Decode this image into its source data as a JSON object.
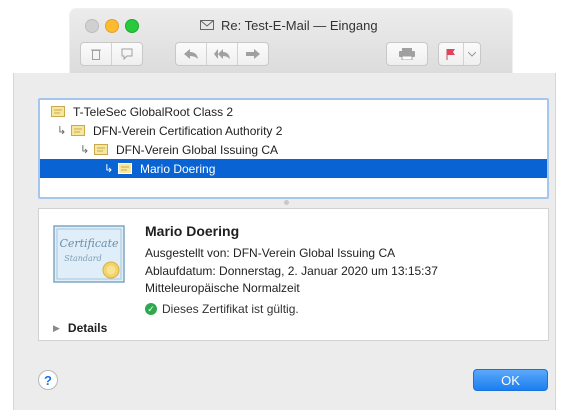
{
  "window": {
    "title": "Re: Test-E-Mail — Eingang",
    "toolbar_icons": [
      "trash-icon",
      "junk-icon",
      "reply-icon",
      "reply-all-icon",
      "forward-icon",
      "print-icon",
      "flag-icon",
      "chevron-down-icon"
    ]
  },
  "tree": {
    "items": [
      {
        "label": "T-TeleSec GlobalRoot Class 2",
        "level": 0
      },
      {
        "label": "DFN-Verein Certification Authority 2",
        "level": 1
      },
      {
        "label": "DFN-Verein Global Issuing CA",
        "level": 2
      },
      {
        "label": "Mario Doering",
        "level": 3,
        "selected": true
      }
    ]
  },
  "details": {
    "name": "Mario Doering",
    "issued_by": "Ausgestellt von: DFN-Verein Global Issuing CA",
    "expires": "Ablaufdatum: Donnerstag, 2. Januar 2020 um 13:15:37",
    "timezone": "Mitteleuropäische Normalzeit",
    "status": "Dieses Zertifikat ist gültig.",
    "details_label": "Details"
  },
  "buttons": {
    "help": "?",
    "ok": "OK"
  },
  "colors": {
    "selection": "#0a63d3",
    "ok_button": "#1b7ff1",
    "valid_check": "#2fa84f",
    "flag": "#e0435a"
  }
}
